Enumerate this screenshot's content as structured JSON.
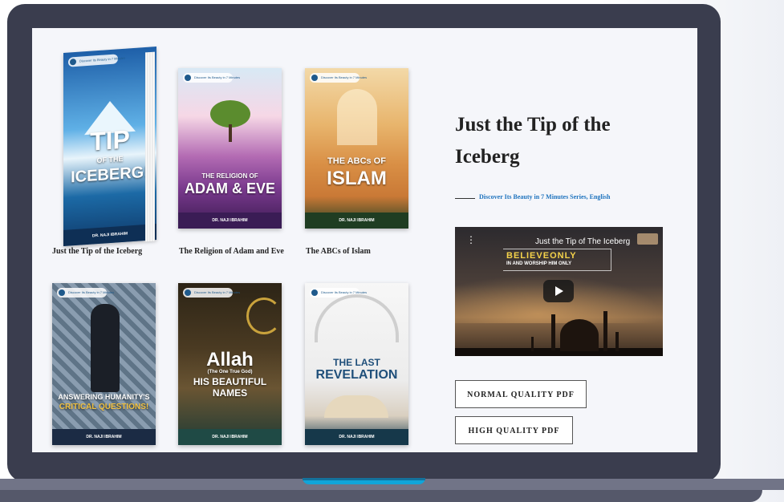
{
  "books": [
    {
      "caption": "Just the Tip of the Iceberg",
      "cover_title": "TIP",
      "cover_sub": "OF THE",
      "cover_title2": "ICEBERG!",
      "badge": "Discover Its Beauty in 7 Minutes",
      "author": "DR. NAJI IBRAHIM"
    },
    {
      "caption": "The Religion of Adam and Eve",
      "cover_sub": "THE RELIGION OF",
      "cover_title": "ADAM & EVE",
      "badge": "Discover Its Beauty in 7 Minutes",
      "author": "DR. NAJI IBRAHIM"
    },
    {
      "caption": "The ABCs of Islam",
      "cover_sub": "THE ABCs OF",
      "cover_title": "ISLAM",
      "badge": "Discover Its Beauty in 7 Minutes",
      "author": "DR. NAJI IBRAHIM"
    },
    {
      "cover_title": "ANSWERING HUMANITY'S",
      "cover_title2": "CRITICAL QUESTIONS!",
      "badge": "Discover Its Beauty in 7 Minutes",
      "author": "DR. NAJI IBRAHIM"
    },
    {
      "cover_title": "Allah",
      "cover_sub": "(The One True God)",
      "cover_title2": "HIS BEAUTIFUL NAMES",
      "badge": "Discover Its Beauty in 7 Minutes",
      "author": "DR. NAJI IBRAHIM"
    },
    {
      "cover_title": "THE LAST",
      "cover_title2": "REVELATION",
      "badge": "Discover Its Beauty in 7 Minutes",
      "author": "DR. NAJI IBRAHIM"
    }
  ],
  "detail": {
    "title": "Just the Tip of the Iceberg",
    "series": "Discover Its Beauty in 7 Minutes Series, English"
  },
  "video": {
    "title": "Just the Tip of The Iceberg",
    "overlay_line1": "BELIEVEONLY",
    "overlay_line2": "IN AND WORSHIP HIM ONLY",
    "menu_glyph": "⋮"
  },
  "buttons": {
    "normal_pdf": "NORMAL QUALITY PDF",
    "high_pdf": "HIGH QUALITY PDF"
  },
  "colors": {
    "laptop_frame": "#3a3d4e",
    "accent_notch": "#10a5d9",
    "link_blue": "#1e73be",
    "screen_bg": "#f5f6fa"
  }
}
